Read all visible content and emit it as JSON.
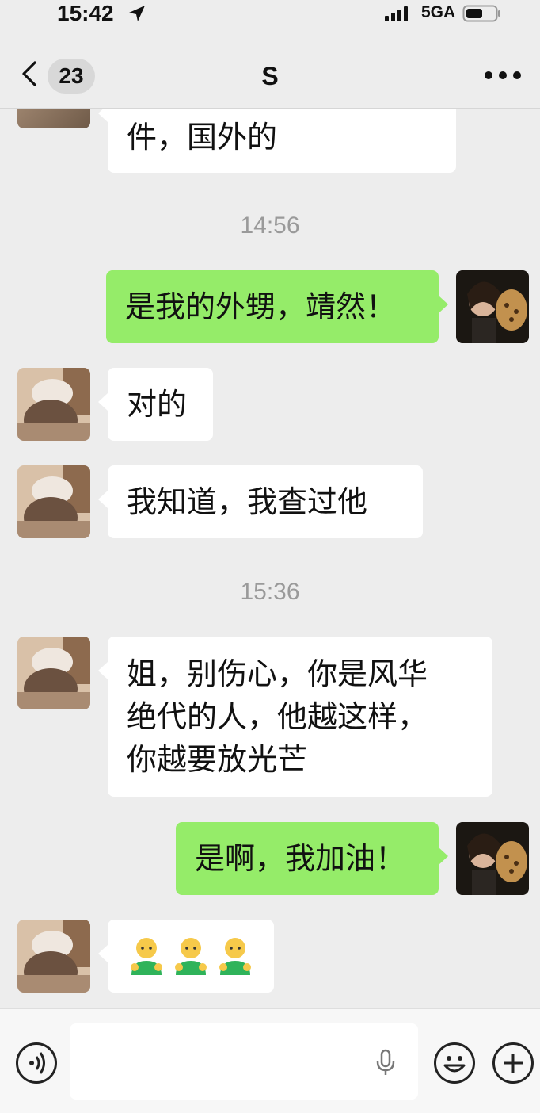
{
  "status_bar": {
    "time": "15:42",
    "network": "5GA"
  },
  "nav": {
    "unread_count": "23",
    "title": "S"
  },
  "messages": {
    "m0_text": "件，国外的",
    "t1": "14:56",
    "m1_text": "是我的外甥，靖然！",
    "m2_text": "对的",
    "m3_text": "我知道，我查过他",
    "t2": "15:36",
    "m4_line1": "姐，别伤心，你是风华",
    "m4_line2": "绝代的人，他越这样，",
    "m4_line3": "你越要放光芒",
    "m5_text": "是啊，我加油！",
    "m6_emoji": "🧑×3"
  },
  "colors": {
    "outgoing_bubble": "#95ec69",
    "incoming_bubble": "#ffffff",
    "background": "#ededed"
  }
}
